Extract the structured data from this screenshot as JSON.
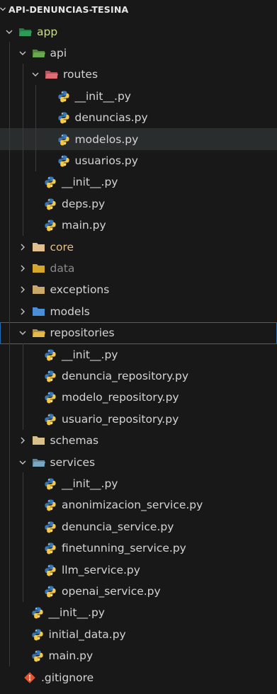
{
  "explorer": {
    "root_label": "API-DENUNCIAS-TESINA",
    "tree": [
      {
        "label": "app",
        "kind": "folder",
        "icon": "app-folder-icon",
        "depth": 0,
        "expanded": true,
        "color": "#2e9c55",
        "label_color": "#c5e478"
      },
      {
        "label": "api",
        "kind": "folder",
        "icon": "api-folder-icon",
        "depth": 1,
        "expanded": true,
        "color": "#6aa84f"
      },
      {
        "label": "routes",
        "kind": "folder",
        "icon": "routes-folder-icon",
        "depth": 2,
        "expanded": true,
        "color": "#e06c75"
      },
      {
        "label": "__init__.py",
        "kind": "python",
        "icon": "python-file-icon",
        "depth": 3
      },
      {
        "label": "denuncias.py",
        "kind": "python",
        "icon": "python-file-icon",
        "depth": 3
      },
      {
        "label": "modelos.py",
        "kind": "python",
        "icon": "python-file-icon",
        "depth": 3,
        "selected": true
      },
      {
        "label": "usuarios.py",
        "kind": "python",
        "icon": "python-file-icon",
        "depth": 3
      },
      {
        "label": "__init__.py",
        "kind": "python",
        "icon": "python-file-icon",
        "depth": 2
      },
      {
        "label": "deps.py",
        "kind": "python",
        "icon": "python-file-icon",
        "depth": 2
      },
      {
        "label": "main.py",
        "kind": "python",
        "icon": "python-file-icon",
        "depth": 2
      },
      {
        "label": "core",
        "kind": "folder",
        "icon": "core-folder-icon",
        "depth": 1,
        "expanded": false,
        "color": "#e2c08d",
        "label_color": "#e2c08d"
      },
      {
        "label": "data",
        "kind": "folder",
        "icon": "data-folder-icon",
        "depth": 1,
        "expanded": false,
        "color": "#d4a72c",
        "label_color": "#8a8a8a"
      },
      {
        "label": "exceptions",
        "kind": "folder",
        "icon": "exceptions-folder-icon",
        "depth": 1,
        "expanded": false,
        "color": "#c9a86a"
      },
      {
        "label": "models",
        "kind": "folder",
        "icon": "models-folder-icon",
        "depth": 1,
        "expanded": false,
        "color": "#4a8fd6"
      },
      {
        "label": "repositories",
        "kind": "folder",
        "icon": "repositories-folder-icon",
        "depth": 1,
        "expanded": true,
        "color": "#e7b94a",
        "focused": true
      },
      {
        "label": "__init__.py",
        "kind": "python",
        "icon": "python-file-icon",
        "depth": 2
      },
      {
        "label": "denuncia_repository.py",
        "kind": "python",
        "icon": "python-file-icon",
        "depth": 2
      },
      {
        "label": "modelo_repository.py",
        "kind": "python",
        "icon": "python-file-icon",
        "depth": 2
      },
      {
        "label": "usuario_repository.py",
        "kind": "python",
        "icon": "python-file-icon",
        "depth": 2
      },
      {
        "label": "schemas",
        "kind": "folder",
        "icon": "schemas-folder-icon",
        "depth": 1,
        "expanded": false,
        "color": "#d9c08a"
      },
      {
        "label": "services",
        "kind": "folder",
        "icon": "services-folder-icon",
        "depth": 1,
        "expanded": true,
        "color": "#7aa6c2"
      },
      {
        "label": "__init__.py",
        "kind": "python",
        "icon": "python-file-icon",
        "depth": 2
      },
      {
        "label": "anonimizacion_service.py",
        "kind": "python",
        "icon": "python-file-icon",
        "depth": 2
      },
      {
        "label": "denuncia_service.py",
        "kind": "python",
        "icon": "python-file-icon",
        "depth": 2
      },
      {
        "label": "finetunning_service.py",
        "kind": "python",
        "icon": "python-file-icon",
        "depth": 2
      },
      {
        "label": "llm_service.py",
        "kind": "python",
        "icon": "python-file-icon",
        "depth": 2
      },
      {
        "label": "openai_service.py",
        "kind": "python",
        "icon": "python-file-icon",
        "depth": 2
      },
      {
        "label": "__init__.py",
        "kind": "python",
        "icon": "python-file-icon",
        "depth": 1
      },
      {
        "label": "initial_data.py",
        "kind": "python",
        "icon": "python-file-icon",
        "depth": 1
      },
      {
        "label": "main.py",
        "kind": "python",
        "icon": "python-file-icon",
        "depth": 1
      },
      {
        "label": ".gitignore",
        "kind": "git",
        "icon": "git-file-icon",
        "depth": 0
      }
    ]
  },
  "colors": {
    "background": "#181818",
    "selected_row": "#2a2d2e",
    "focus_border": "#1f6cb5",
    "python_blue": "#3a78b5",
    "python_yellow": "#f7c948",
    "git": "#e8542f"
  }
}
